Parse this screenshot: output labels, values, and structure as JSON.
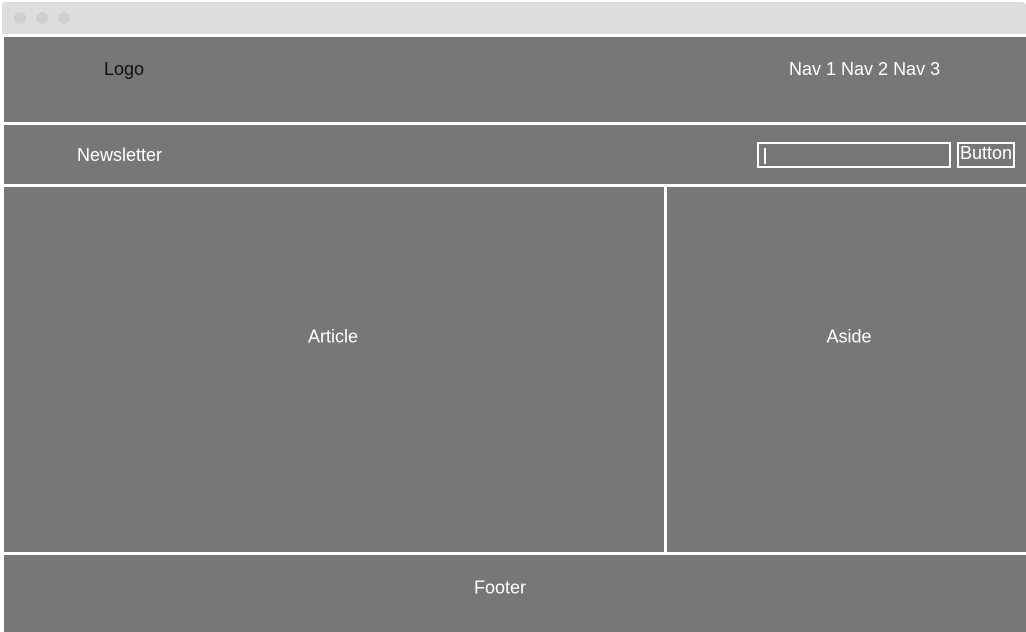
{
  "header": {
    "logo": "Logo",
    "nav": [
      "Nav 1",
      "Nav 2",
      "Nav 3"
    ]
  },
  "newsletter": {
    "label": "Newsletter",
    "input_value": "",
    "button_label": "Button"
  },
  "main": {
    "article_label": "Article",
    "aside_label": "Aside"
  },
  "footer": {
    "label": "Footer"
  },
  "colors": {
    "block": "#777777",
    "titlebar": "#dddddd",
    "text": "#ffffff"
  }
}
